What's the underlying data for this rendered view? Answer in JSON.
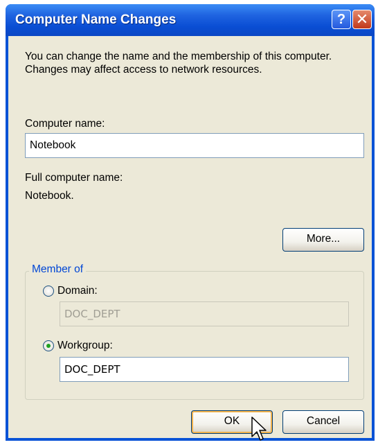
{
  "window": {
    "title": "Computer Name Changes",
    "help_button_glyph": "?",
    "close_button_glyph": "✕"
  },
  "description": "You can change the name and the membership of this computer. Changes may affect access to network resources.",
  "computer_name": {
    "label": "Computer name:",
    "value": "Notebook"
  },
  "full_computer_name": {
    "label": "Full computer name:",
    "value": "Notebook."
  },
  "more_button": "More...",
  "member_of": {
    "label": "Member of",
    "domain": {
      "label": "Domain:",
      "value": "DOC_DEPT",
      "selected": false
    },
    "workgroup": {
      "label": "Workgroup:",
      "value": "DOC_DEPT",
      "selected": true
    }
  },
  "buttons": {
    "ok": "OK",
    "cancel": "Cancel"
  },
  "colors": {
    "title_bar": "#0a53d6",
    "dialog_bg": "#ece9d8",
    "group_label": "#0046d5",
    "radio_dot": "#21a121"
  },
  "icons": {
    "help": "help-icon",
    "close": "close-icon",
    "cursor": "mouse-pointer-icon"
  }
}
